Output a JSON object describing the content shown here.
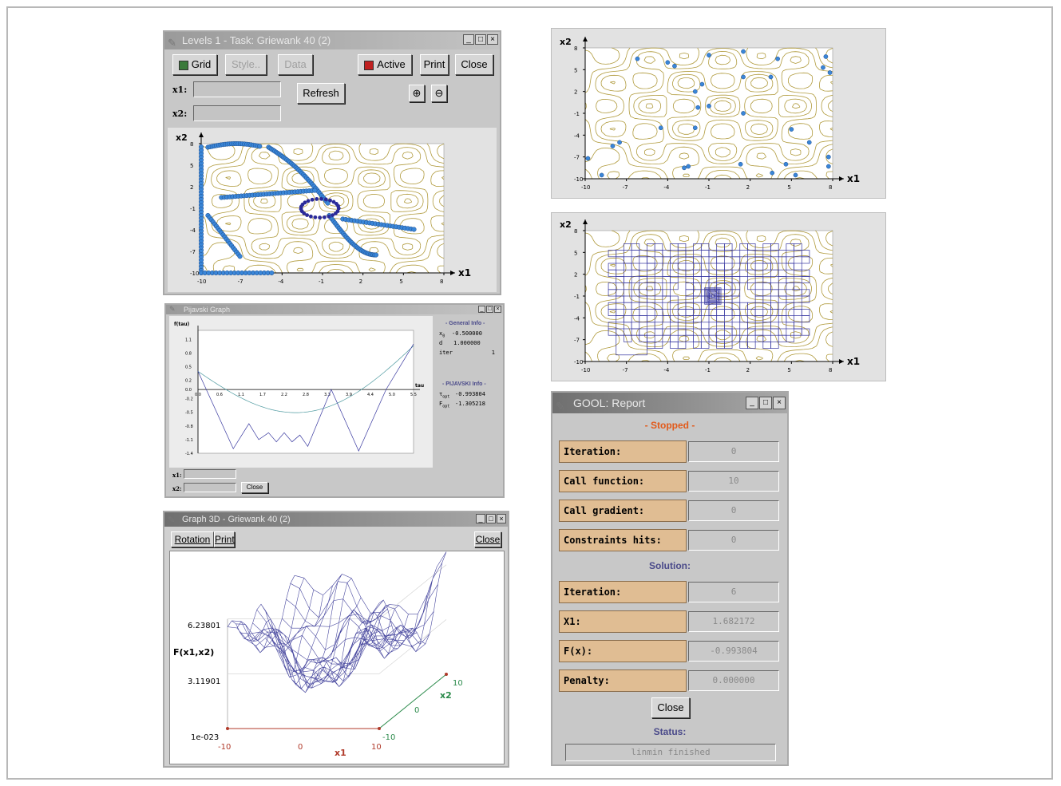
{
  "levels_window": {
    "title": "Levels 1 - Task: Griewank 40 (2)",
    "buttons": {
      "grid": "Grid",
      "style": "Style..",
      "data": "Data",
      "active": "Active",
      "print": "Print",
      "close": "Close",
      "refresh": "Refresh"
    },
    "fields": {
      "x1_label": "x1:",
      "x2_label": "x2:"
    },
    "plot": {
      "y_label": "x2",
      "x_label": "x1",
      "x_ticks": [
        "-10",
        "-7",
        "-4",
        "-1",
        "2",
        "5",
        "8"
      ],
      "y_ticks": [
        "8",
        "5",
        "2",
        "-1",
        "-4",
        "-7",
        "-10"
      ]
    }
  },
  "pijavski_window": {
    "title": "Pijavski Graph",
    "y_label": "f(tau)",
    "x_label": "tau",
    "y_ticks": [
      "1.1",
      "0.8",
      "0.5",
      "0.2",
      "0.0",
      "-0.2",
      "-0.5",
      "-0.8",
      "-1.1",
      "-1.4"
    ],
    "x_ticks": [
      "0.0",
      "0.6",
      "1.1",
      "1.7",
      "2.2",
      "2.8",
      "3.3",
      "3.9",
      "4.4",
      "5.0",
      "5.5"
    ],
    "general_info": {
      "header": "- General Info -",
      "x0_label": "x",
      "x0_sub": "0",
      "x0_value": "-0.500000",
      "d_label": "d",
      "d_value": "1.000000",
      "iter_label": "iter",
      "iter_value": "1"
    },
    "pijavski_info": {
      "header": "- PIJAVSKI Info -",
      "topt_label": "τ",
      "topt_sub": "opt",
      "topt_value": "-0.993804",
      "fopt_label": "F",
      "fopt_sub": "opt",
      "fopt_value": "-1.305218"
    },
    "x1_label": "x1:",
    "x2_label": "x2:",
    "close": "Close"
  },
  "graph3d_window": {
    "title": "Graph 3D - Griewank 40 (2)",
    "buttons": {
      "rotation": "Rotation",
      "print": "Print",
      "close": "Close"
    },
    "z_label": "F(x1,x2)",
    "z_ticks": [
      "6.23801",
      "3.11901",
      "1e-023"
    ],
    "x_ticks": [
      "-10",
      "0",
      "10"
    ],
    "x_label": "x1",
    "y_ticks": [
      "-10",
      "0",
      "10"
    ],
    "y_label": "x2"
  },
  "scatter_plot": {
    "y_label": "x2",
    "x_label": "x1",
    "x_ticks": [
      "-10",
      "-7",
      "-4",
      "-1",
      "2",
      "5",
      "8"
    ],
    "y_ticks": [
      "8",
      "5",
      "2",
      "-1",
      "-4",
      "-7",
      "-10"
    ]
  },
  "grid_plot": {
    "y_label": "x2",
    "x_label": "x1",
    "x_ticks": [
      "-10",
      "-7",
      "-4",
      "-1",
      "2",
      "5",
      "8"
    ],
    "y_ticks": [
      "8",
      "5",
      "2",
      "-1",
      "-4",
      "-7",
      "-10"
    ]
  },
  "report_window": {
    "title": "GOOL: Report",
    "state": "- Stopped -",
    "rows1": [
      {
        "label": "Iteration:",
        "value": "0"
      },
      {
        "label": "Call function:",
        "value": "10"
      },
      {
        "label": "Call gradient:",
        "value": "0"
      },
      {
        "label": "Constraints hits:",
        "value": "0"
      }
    ],
    "solution_header": "Solution:",
    "rows2": [
      {
        "label": "Iteration:",
        "value": "6"
      },
      {
        "label": "X1:",
        "value": "1.682172"
      },
      {
        "label": "F(x):",
        "value": "-0.993804"
      },
      {
        "label": "Penalty:",
        "value": "0.000000"
      }
    ],
    "close": "Close",
    "status_header": "Status:",
    "status_value": "linmin finished"
  },
  "colors": {
    "contour": "#b09a3c",
    "points": "#3a86d8",
    "path_dark": "#2a2a9a",
    "grid_lines": "#3535a0",
    "report_title": "#e25a1a",
    "report_header": "#4a4a8a"
  }
}
